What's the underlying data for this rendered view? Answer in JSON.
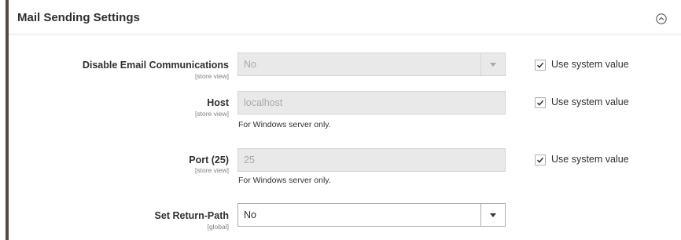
{
  "section": {
    "title": "Mail Sending Settings",
    "collapse_icon": "chevron-up-circle-icon"
  },
  "rows": [
    {
      "label": "Disable Email Communications",
      "scope": "[store view]",
      "type": "select",
      "value": "No",
      "disabled": true,
      "note": "",
      "use_system_value": {
        "checked": true,
        "label": "Use system value"
      }
    },
    {
      "label": "Host",
      "scope": "[store view]",
      "type": "text",
      "value": "localhost",
      "disabled": true,
      "note": "For Windows server only.",
      "use_system_value": {
        "checked": true,
        "label": "Use system value"
      }
    },
    {
      "label": "Port (25)",
      "scope": "[store view]",
      "type": "text",
      "value": "25",
      "disabled": true,
      "note": "For Windows server only.",
      "use_system_value": {
        "checked": true,
        "label": "Use system value"
      }
    },
    {
      "label": "Set Return-Path",
      "scope": "[global]",
      "type": "select",
      "value": "No",
      "disabled": false,
      "note": ""
    }
  ],
  "colors": {
    "accent_border": "#514943",
    "disabled_bg": "#e9e9e9",
    "text": "#303030"
  }
}
